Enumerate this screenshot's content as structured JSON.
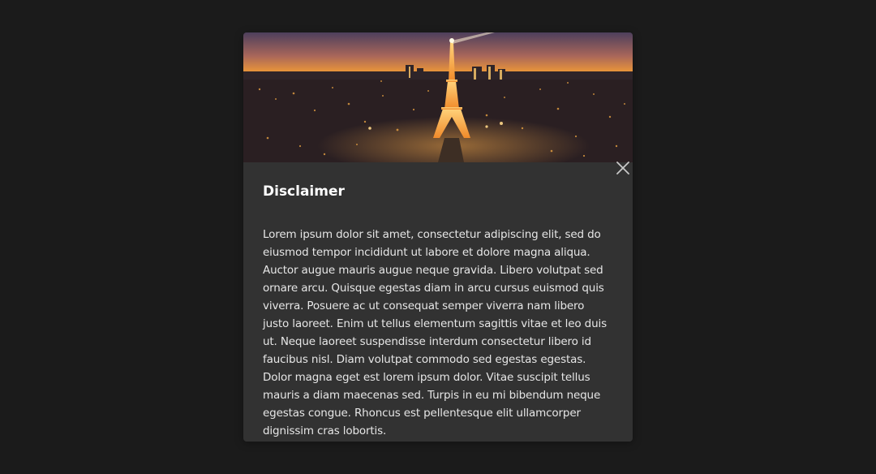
{
  "dialog": {
    "hero_image": "eiffel-tower-night-panorama",
    "close_icon": "close-icon",
    "title": "Disclaimer",
    "body": "Lorem ipsum dolor sit amet, consectetur adipiscing elit, sed do eiusmod tempor incididunt ut labore et dolore magna aliqua. Auctor augue mauris augue neque gravida. Libero volutpat sed ornare arcu. Quisque egestas diam in arcu cursus euismod quis viverra. Posuere ac ut consequat semper viverra nam libero justo laoreet. Enim ut tellus elementum sagittis vitae et leo duis ut. Neque laoreet suspendisse interdum consectetur libero id faucibus nisl. Diam volutpat commodo sed egestas egestas. Dolor magna eget est lorem ipsum dolor. Vitae suscipit tellus mauris a diam maecenas sed. Turpis in eu mi bibendum neque egestas congue. Rhoncus est pellentesque elit ullamcorper dignissim cras lobortis."
  },
  "colors": {
    "backdrop": "#1b1b1b",
    "dialog_bg": "#323232",
    "title": "#ffffff",
    "body": "#e6e6e6",
    "sky_top": "#5a4a6a",
    "sky_glow": "#e8943a",
    "city_lights": "#f5b24a"
  }
}
